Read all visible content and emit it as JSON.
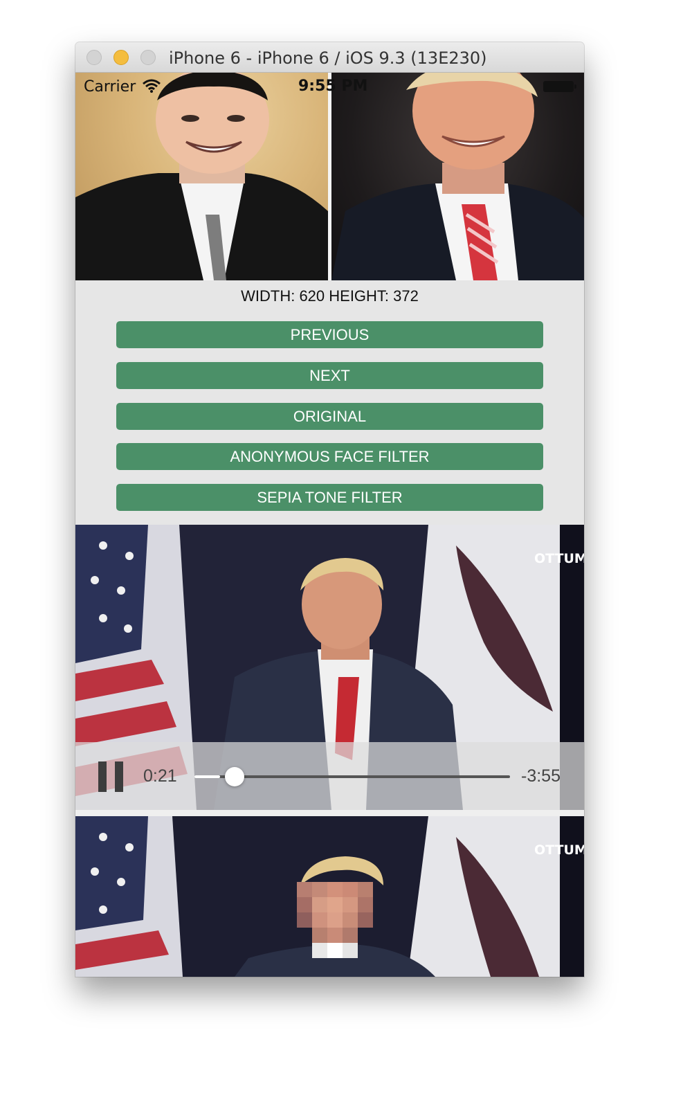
{
  "window": {
    "title": "iPhone 6 - iPhone 6 / iOS 9.3 (13E230)"
  },
  "statusbar": {
    "carrier": "Carrier",
    "time": "9:55 PM"
  },
  "image_info": {
    "dimensions": "WIDTH: 620 HEIGHT: 372"
  },
  "buttons": {
    "previous": "PREVIOUS",
    "next": "NEXT",
    "original": "ORIGINAL",
    "anonymous": "ANONYMOUS FACE FILTER",
    "sepia": "SEPIA TONE FILTER"
  },
  "video_player": {
    "elapsed": "0:21",
    "remaining": "-3:55",
    "progress": 0.0818
  },
  "video_overlay": {
    "watermark": "OTTUM"
  },
  "colors": {
    "button": "#4b9068",
    "traffic_minimize": "#f4bd3f"
  }
}
